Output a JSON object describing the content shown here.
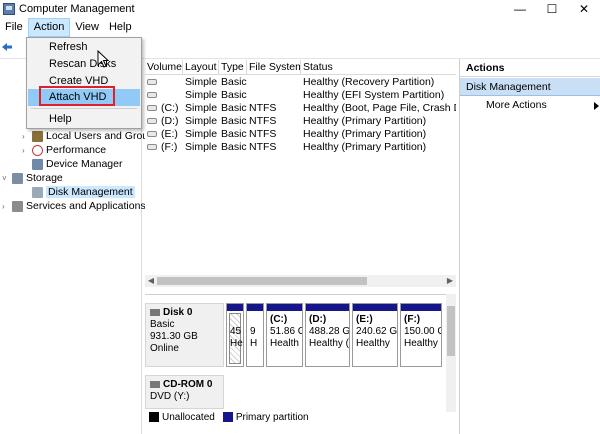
{
  "window": {
    "title": "Computer Management",
    "controls": {
      "minimize": "—",
      "maximize": "☐",
      "close": "✕"
    }
  },
  "menubar": [
    "File",
    "Action",
    "View",
    "Help"
  ],
  "context_menu": {
    "items": [
      "Refresh",
      "Rescan Disks",
      "Create VHD",
      "Attach VHD",
      "Help"
    ],
    "highlighted": "Attach VHD"
  },
  "tree": {
    "items": [
      {
        "label": "Local Users and Groups",
        "icon": "users-icon"
      },
      {
        "label": "Performance",
        "icon": "performance-icon"
      },
      {
        "label": "Device Manager",
        "icon": "device-manager-icon"
      },
      {
        "label": "Storage",
        "icon": "storage-icon"
      },
      {
        "label": "Disk Management",
        "icon": "disk-management-icon"
      },
      {
        "label": "Services and Applications",
        "icon": "services-icon"
      }
    ]
  },
  "volumes": {
    "columns": [
      "Volume",
      "Layout",
      "Type",
      "File System",
      "Status"
    ],
    "rows": [
      {
        "volume": "",
        "layout": "Simple",
        "type": "Basic",
        "fs": "",
        "status": "Healthy (Recovery Partition)"
      },
      {
        "volume": "",
        "layout": "Simple",
        "type": "Basic",
        "fs": "",
        "status": "Healthy (EFI System Partition)"
      },
      {
        "volume": "(C:)",
        "layout": "Simple",
        "type": "Basic",
        "fs": "NTFS",
        "status": "Healthy (Boot, Page File, Crash Dum"
      },
      {
        "volume": "(D:)",
        "layout": "Simple",
        "type": "Basic",
        "fs": "NTFS",
        "status": "Healthy (Primary Partition)"
      },
      {
        "volume": "(E:)",
        "layout": "Simple",
        "type": "Basic",
        "fs": "NTFS",
        "status": "Healthy (Primary Partition)"
      },
      {
        "volume": "(F:)",
        "layout": "Simple",
        "type": "Basic",
        "fs": "NTFS",
        "status": "Healthy (Primary Partition)"
      }
    ]
  },
  "disk0": {
    "name": "Disk 0",
    "type": "Basic",
    "size": "931.30 GB",
    "state": "Online",
    "partitions": [
      {
        "line1": "",
        "line2": "45",
        "line3": "He",
        "hatched": true
      },
      {
        "line1": "",
        "line2": "9",
        "line3": "H",
        "hatched": false
      },
      {
        "line1": "(C:)",
        "line2": "51.86 G",
        "line3": "Health",
        "hatched": false
      },
      {
        "line1": "(D:)",
        "line2": "488.28 GE",
        "line3": "Healthy (",
        "hatched": false
      },
      {
        "line1": "(E:)",
        "line2": "240.62 G",
        "line3": "Healthy",
        "hatched": false
      },
      {
        "line1": "(F:)",
        "line2": "150.00 G",
        "line3": "Healthy",
        "hatched": false
      }
    ]
  },
  "cdrom0": {
    "name": "CD-ROM 0",
    "drive": "DVD (Y:)"
  },
  "legend": [
    {
      "label": "Unallocated",
      "color": "#000000"
    },
    {
      "label": "Primary partition",
      "color": "#14168a"
    }
  ],
  "actions": {
    "title": "Actions",
    "section": "Disk Management",
    "more": "More Actions"
  }
}
